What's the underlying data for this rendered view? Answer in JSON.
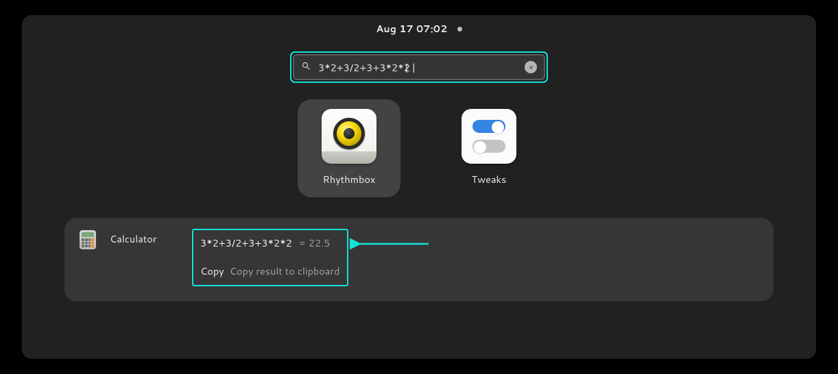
{
  "topbar": {
    "datetime": "Aug 17  07:02"
  },
  "search": {
    "value": "3*2+3/2+3+3*2*2"
  },
  "apps": [
    {
      "name": "Rhythmbox",
      "icon": "rhythmbox"
    },
    {
      "name": "Tweaks",
      "icon": "tweaks"
    }
  ],
  "calculator": {
    "provider": "Calculator",
    "expression": "3*2+3/2+3+3*2*2",
    "result": "= 22.5",
    "copy_label": "Copy",
    "copy_description": "Copy result to clipboard"
  },
  "annotation": {
    "highlight_color": "#14e1d8"
  }
}
